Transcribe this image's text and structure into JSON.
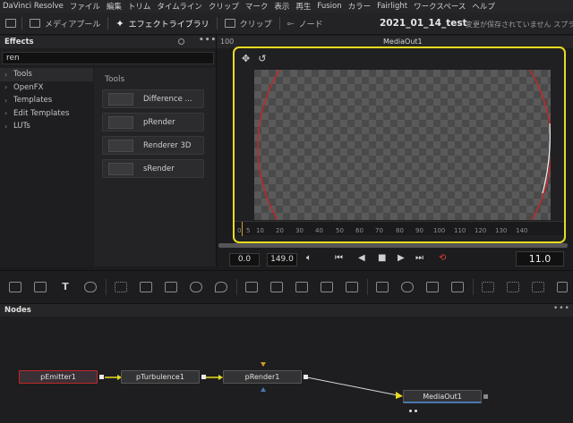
{
  "menu": [
    "DaVinci Resolve",
    "ファイル",
    "編集",
    "トリム",
    "タイムライン",
    "クリップ",
    "マーク",
    "表示",
    "再生",
    "Fusion",
    "カラー",
    "Fairlight",
    "ワークスペース",
    "ヘルプ"
  ],
  "toolbar": {
    "media_pool": "メディアプール",
    "effects_library": "エフェクトライブラリ",
    "clips": "クリップ",
    "nodes": "ノード",
    "project_title": "2021_01_14_test",
    "saved_note": "変更が保存されていません",
    "extra": "スプラ"
  },
  "effects": {
    "title": "Effects",
    "search_value": "ren",
    "tree": [
      "Tools",
      "OpenFX",
      "Templates",
      "Edit Templates",
      "LUTs"
    ],
    "tools_title": "Tools",
    "tools": [
      "Difference ...",
      "pRender",
      "Renderer 3D",
      "sRender"
    ]
  },
  "viewer": {
    "zoom": "100",
    "name": "MediaOut1",
    "ruler_ticks": [
      "0",
      "5",
      "10",
      "20",
      "30",
      "40",
      "50",
      "60",
      "70",
      "80",
      "90",
      "100",
      "110",
      "120",
      "130",
      "140"
    ]
  },
  "transport": {
    "start": "0.0",
    "end": "149.0",
    "current_frame": "11.0"
  },
  "nodes": {
    "title": "Nodes",
    "items": [
      "pEmitter1",
      "pTurbulence1",
      "pRender1",
      "MediaOut1"
    ]
  },
  "colors": {
    "highlight": "#e6dc20",
    "selected_node": "#c02828",
    "flow_arrow": "#e6dc20",
    "loop": "#e04030"
  }
}
